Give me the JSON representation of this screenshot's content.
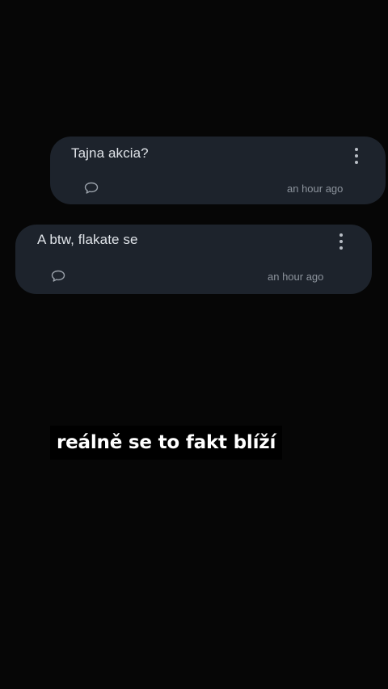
{
  "comments": [
    {
      "text": "Tajna akcia?",
      "timestamp": "an hour ago",
      "reply_icon": "speech-bubble-icon",
      "menu_icon": "more-vertical-icon"
    },
    {
      "text": "A btw, flakate se",
      "timestamp": "an hour ago",
      "reply_icon": "speech-bubble-icon",
      "menu_icon": "more-vertical-icon"
    }
  ],
  "caption": {
    "text": "reálně se to fakt blíží"
  },
  "colors": {
    "background": "#060606",
    "card": "#1d232c",
    "card_text": "#dfe3e8",
    "timestamp": "#8c939c",
    "caption_text": "#ffffff",
    "caption_bg": "#000000"
  }
}
